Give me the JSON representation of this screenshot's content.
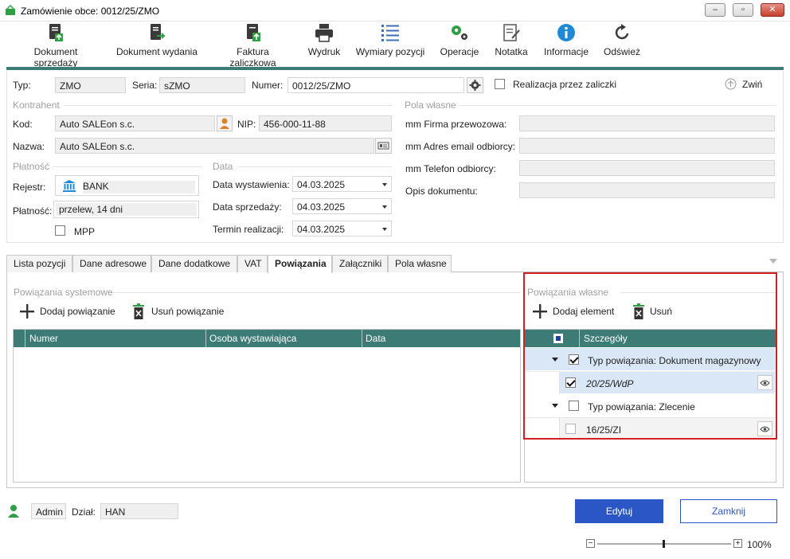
{
  "window": {
    "title": "Zamówienie obce: 0012/25/ZMO",
    "minimize": "‒",
    "restore": "▫",
    "close": "✕"
  },
  "toolbar": [
    {
      "label": "Dokument sprzedaży"
    },
    {
      "label": "Dokument wydania"
    },
    {
      "label": "Faktura zaliczkowa"
    },
    {
      "label": "Wydruk"
    },
    {
      "label": "Wymiary pozycji"
    },
    {
      "label": "Operacje"
    },
    {
      "label": "Notatka"
    },
    {
      "label": "Informacje"
    },
    {
      "label": "Odśwież"
    }
  ],
  "header": {
    "typ_label": "Typ:",
    "typ_value": "ZMO",
    "seria_label": "Seria:",
    "seria_value": "sZMO",
    "numer_label": "Numer:",
    "numer_value": "0012/25/ZMO",
    "zaliczki_label": "Realizacja przez zaliczki",
    "collapse_label": "Zwiń"
  },
  "kontrahent": {
    "group": "Kontrahent",
    "kod_label": "Kod:",
    "kod_value": "Auto SALEon s.c.",
    "nip_label": "NIP:",
    "nip_value": "456-000-11-88",
    "nazwa_label": "Nazwa:",
    "nazwa_value": "Auto SALEon s.c."
  },
  "platnosc": {
    "group": "Płatność",
    "rejestr_label": "Rejestr:",
    "rejestr_value": "BANK",
    "platnosc_label": "Płatność:",
    "platnosc_value": "przelew, 14 dni",
    "mpp_label": "MPP"
  },
  "data": {
    "group": "Data",
    "wystawienia_label": "Data wystawienia:",
    "wystawienia_value": "04.03.2025",
    "sprzedazy_label": "Data sprzedaży:",
    "sprzedazy_value": "04.03.2025",
    "termin_label": "Termin realizacji:",
    "termin_value": "04.03.2025"
  },
  "pola_wlasne": {
    "group": "Pola własne",
    "firma_label": "mm Firma przewozowa:",
    "email_label": "mm Adres email odbiorcy:",
    "telefon_label": "mm Telefon odbiorcy:",
    "opis_label": "Opis dokumentu:"
  },
  "tabs": [
    {
      "label": "Lista pozycji"
    },
    {
      "label": "Dane adresowe"
    },
    {
      "label": "Dane dodatkowe"
    },
    {
      "label": "VAT"
    },
    {
      "label": "Powiązania"
    },
    {
      "label": "Załączniki"
    },
    {
      "label": "Pola własne"
    }
  ],
  "system_links": {
    "group": "Powiązania systemowe",
    "add_label": "Dodaj powiązanie",
    "remove_label": "Usuń powiązanie",
    "columns": [
      "Numer",
      "Osoba wystawiająca",
      "Data"
    ]
  },
  "own_links": {
    "group": "Powiązania własne",
    "add_label": "Dodaj element",
    "remove_label": "Usuń",
    "column": "Szczegóły",
    "rows": [
      {
        "text": "Typ powiązania: Dokument magazynowy",
        "checked": true
      },
      {
        "text": "20/25/WdP",
        "checked": true
      },
      {
        "text": "Typ powiązania: Zlecenie",
        "checked": false
      },
      {
        "text": "16/25/ZI",
        "checked": false
      }
    ]
  },
  "footer": {
    "user": "Admin",
    "dzial_label": "Dział:",
    "dzial_value": "HAN",
    "edit_label": "Edytuj",
    "close_label": "Zamknij",
    "zoom": "100%",
    "zoom_minus": "−",
    "zoom_plus": "+"
  },
  "colors": {
    "accent": "#3d7b77",
    "primary_button": "#2a56c6",
    "highlight_border": "#d21f1f"
  }
}
